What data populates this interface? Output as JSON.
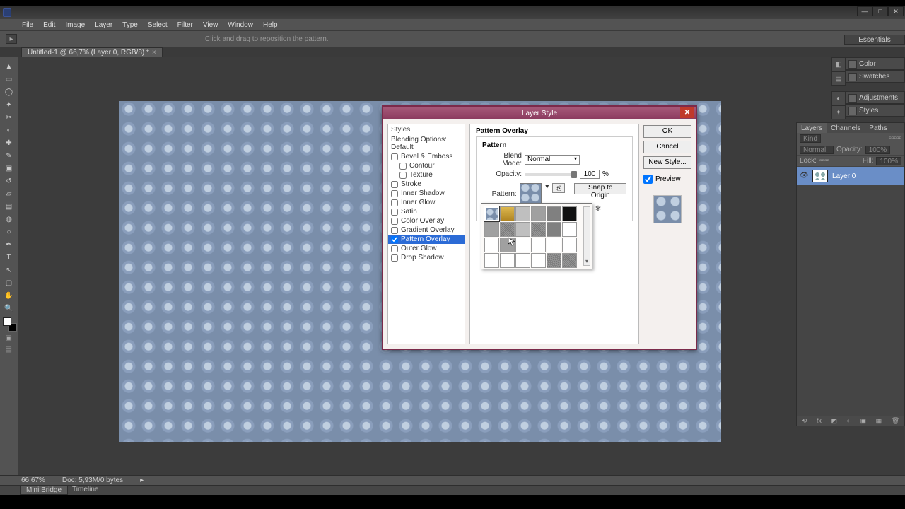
{
  "title": "Ps",
  "menu": [
    "File",
    "Edit",
    "Image",
    "Layer",
    "Type",
    "Select",
    "Filter",
    "View",
    "Window",
    "Help"
  ],
  "optbar": {
    "hint": "Click and drag to reposition the pattern."
  },
  "essentials": "Essentials",
  "doctab": {
    "label": "Untitled-1 @ 66,7% (Layer 0, RGB/8) *"
  },
  "rt_panels1": [
    "Color",
    "Swatches"
  ],
  "rt_panels2": [
    "Adjustments",
    "Styles"
  ],
  "rt_panels3": [
    "Layers",
    "Channels",
    "Paths"
  ],
  "layers_panel": {
    "tabs": [
      "Layers",
      "Channels",
      "Paths"
    ],
    "kind": "Kind",
    "mode": "Normal",
    "opacity_label": "Opacity:",
    "opacity_val": "100%",
    "lock_label": "Lock:",
    "fill_label": "Fill:",
    "fill_val": "100%",
    "layer": {
      "name": "Layer 0"
    }
  },
  "status": {
    "zoom": "66,67%",
    "doc": "Doc: 5,93M/0 bytes"
  },
  "bottom_tabs": {
    "mini": "Mini Bridge",
    "timeline": "Timeline"
  },
  "dialog": {
    "title": "Layer Style",
    "styles_header": "Styles",
    "blend_default": "Blending Options: Default",
    "effects": {
      "bevel": "Bevel & Emboss",
      "contour": "Contour",
      "texture": "Texture",
      "stroke": "Stroke",
      "inner_shadow": "Inner Shadow",
      "inner_glow": "Inner Glow",
      "satin": "Satin",
      "color_overlay": "Color Overlay",
      "gradient_overlay": "Gradient Overlay",
      "pattern_overlay": "Pattern Overlay",
      "outer_glow": "Outer Glow",
      "drop_shadow": "Drop Shadow"
    },
    "section": "Pattern Overlay",
    "group_title": "Pattern",
    "blend_mode_label": "Blend Mode:",
    "blend_mode_value": "Normal",
    "opacity_label": "Opacity:",
    "opacity_value": "100",
    "opacity_pct": "%",
    "pattern_label": "Pattern:",
    "snap_label": "Snap to Origin",
    "ok": "OK",
    "cancel": "Cancel",
    "new_style": "New Style...",
    "preview": "Preview"
  }
}
